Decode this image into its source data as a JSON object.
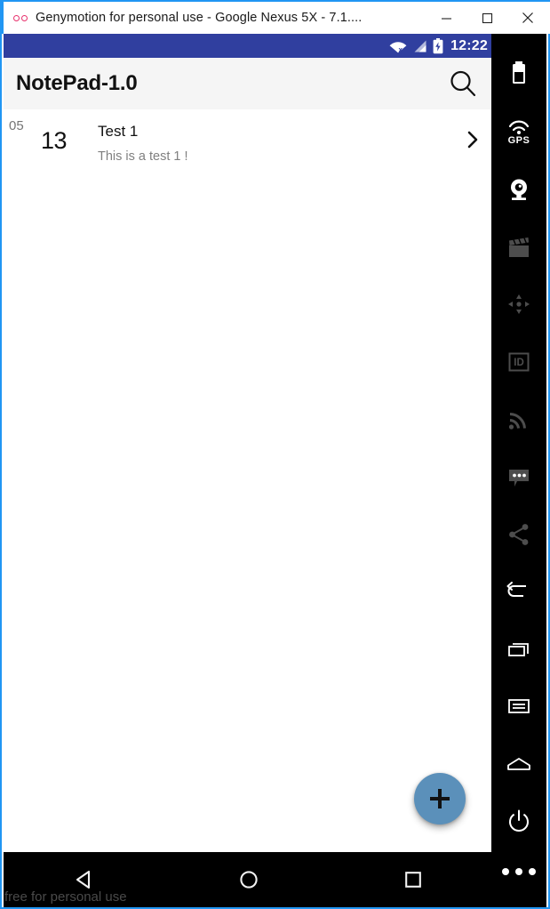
{
  "window": {
    "title": "Genymotion for personal use - Google Nexus 5X - 7.1....",
    "logo_icon": "genymotion-logo-icon",
    "controls": {
      "minimize": "minimize-button",
      "maximize": "maximize-button",
      "close": "close-button"
    },
    "accent_color": "#2196f3"
  },
  "statusbar": {
    "time": "12:22",
    "icons": [
      "wifi-no-internet-icon",
      "cellular-signal-icon",
      "battery-charging-icon"
    ],
    "background_color": "#303f9f"
  },
  "appbar": {
    "title": "NotePad-1.0",
    "search_label": "Search",
    "background_color": "#f5f5f5"
  },
  "notes": [
    {
      "month": "05",
      "day": "13",
      "title": "Test 1",
      "subtitle": "This is a test 1 !",
      "chevron": "chevron-right-icon"
    }
  ],
  "fab": {
    "label": "+",
    "aria": "Add note",
    "color": "#5b90ba"
  },
  "navbar": {
    "buttons": [
      {
        "name": "back-button",
        "icon": "triangle-back-icon"
      },
      {
        "name": "home-button",
        "icon": "circle-home-icon"
      },
      {
        "name": "recents-button",
        "icon": "square-recents-icon"
      }
    ]
  },
  "watermark": "free for personal use",
  "toolbar": {
    "items": [
      {
        "name": "battery-tool",
        "icon": "battery-icon",
        "label": ""
      },
      {
        "name": "gps-tool",
        "icon": "gps-icon",
        "label": "GPS"
      },
      {
        "name": "camera-tool",
        "icon": "webcam-icon",
        "label": ""
      },
      {
        "name": "screencast-tool",
        "icon": "clapperboard-icon",
        "label": ""
      },
      {
        "name": "accelerometer-tool",
        "icon": "dpad-move-icon",
        "label": ""
      },
      {
        "name": "identifiers-tool",
        "icon": "id-badge-icon",
        "label": ""
      },
      {
        "name": "network-tool",
        "icon": "signal-waves-icon",
        "label": ""
      },
      {
        "name": "sms-tool",
        "icon": "chat-bubble-icon",
        "label": ""
      },
      {
        "name": "share-tool",
        "icon": "share-nodes-icon",
        "label": ""
      },
      {
        "name": "back-tool",
        "icon": "back-arrow-icon",
        "label": ""
      },
      {
        "name": "recents-tool",
        "icon": "windows-stack-icon",
        "label": ""
      },
      {
        "name": "menu-tool",
        "icon": "menu-lines-icon",
        "label": ""
      },
      {
        "name": "home-tool",
        "icon": "home-pentagon-icon",
        "label": ""
      },
      {
        "name": "power-tool",
        "icon": "power-icon",
        "label": ""
      },
      {
        "name": "more-tool",
        "icon": "more-dots-icon",
        "label": ""
      }
    ]
  }
}
